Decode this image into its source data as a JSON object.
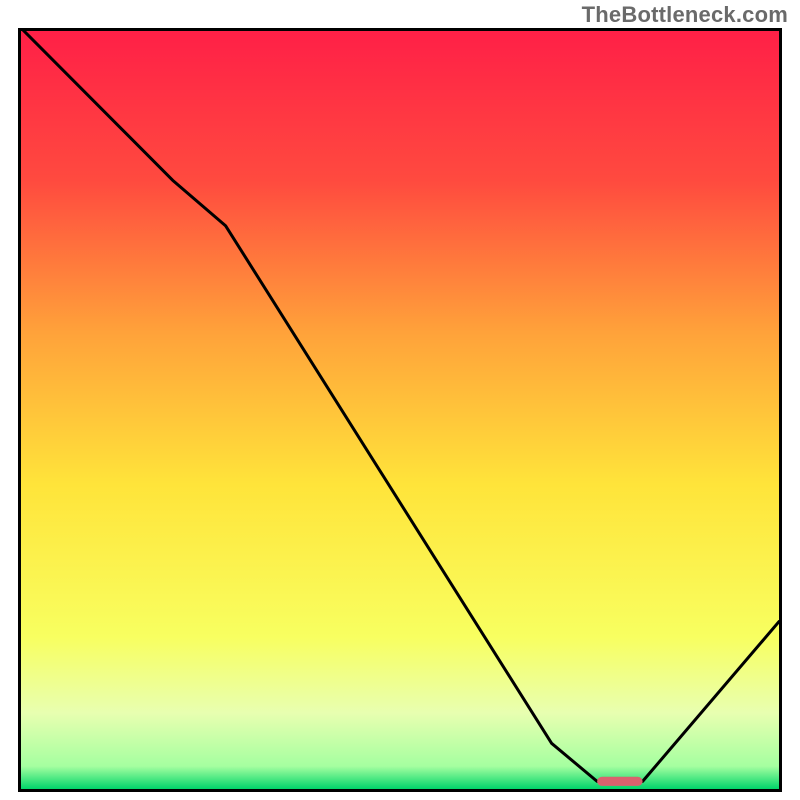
{
  "watermark": "TheBottleneck.com",
  "chart_data": {
    "type": "line",
    "title": "",
    "xlabel": "",
    "ylabel": "",
    "xlim": [
      0,
      100
    ],
    "ylim": [
      0,
      100
    ],
    "gradient_stops": [
      {
        "offset": 0.0,
        "color": "#ff1f47"
      },
      {
        "offset": 0.2,
        "color": "#ff4a3f"
      },
      {
        "offset": 0.4,
        "color": "#ffa23a"
      },
      {
        "offset": 0.6,
        "color": "#ffe43a"
      },
      {
        "offset": 0.8,
        "color": "#f8ff60"
      },
      {
        "offset": 0.9,
        "color": "#e8ffb0"
      },
      {
        "offset": 0.97,
        "color": "#a5ffa0"
      },
      {
        "offset": 1.0,
        "color": "#00d46a"
      }
    ],
    "series": [
      {
        "name": "bottleneck-curve",
        "color": "#000000",
        "x": [
          0,
          20,
          27,
          70,
          76,
          82,
          100
        ],
        "values": [
          100,
          80,
          74,
          6,
          1,
          1,
          22
        ]
      }
    ],
    "marker": {
      "name": "optimal-range",
      "color": "#d9626e",
      "x_start": 76,
      "x_end": 82,
      "y": 1,
      "thickness_pct": 1.2
    },
    "axes": {
      "stroke": "#000000",
      "stroke_width": 3
    }
  }
}
